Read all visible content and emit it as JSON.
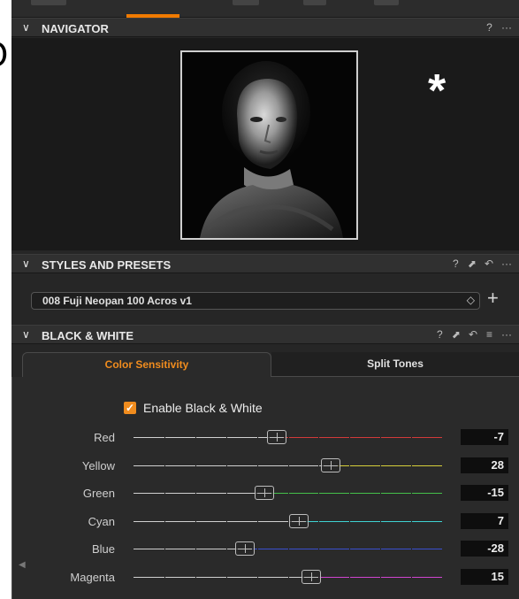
{
  "edge_glyph": "O",
  "navigator": {
    "title": "NAVIGATOR",
    "tools": [
      "?",
      "···"
    ],
    "overlay_symbol": "*"
  },
  "styles_and_presets": {
    "title": "STYLES AND PRESETS",
    "tools": [
      "?",
      "⬈",
      "↶",
      "···"
    ],
    "selected_preset": "008 Fuji Neopan 100 Acros v1",
    "select_arrows": "◇",
    "add_button": "+"
  },
  "black_white": {
    "title": "BLACK & WHITE",
    "tools": [
      "?",
      "⬈",
      "↶",
      "≡",
      "···"
    ],
    "tabs": [
      {
        "label": "Color Sensitivity",
        "active": true
      },
      {
        "label": "Split Tones",
        "active": false
      }
    ],
    "enable": {
      "label": "Enable Black & White",
      "checked": true,
      "check_glyph": "✓"
    },
    "sliders": [
      {
        "name": "Red",
        "value": "-7",
        "color": "#d23a3a",
        "range": [
          -100,
          100
        ]
      },
      {
        "name": "Yellow",
        "value": "28",
        "color": "#d6cf3a",
        "range": [
          -100,
          100
        ]
      },
      {
        "name": "Green",
        "value": "-15",
        "color": "#45c04a",
        "range": [
          -100,
          100
        ]
      },
      {
        "name": "Cyan",
        "value": "7",
        "color": "#3fd2d2",
        "range": [
          -100,
          100
        ]
      },
      {
        "name": "Blue",
        "value": "-28",
        "color": "#3a4fd0",
        "range": [
          -100,
          100
        ]
      },
      {
        "name": "Magenta",
        "value": "15",
        "color": "#cf45cf",
        "range": [
          -100,
          100
        ]
      }
    ]
  },
  "colors": {
    "accent": "#f08c1e",
    "panel": "#262626"
  }
}
